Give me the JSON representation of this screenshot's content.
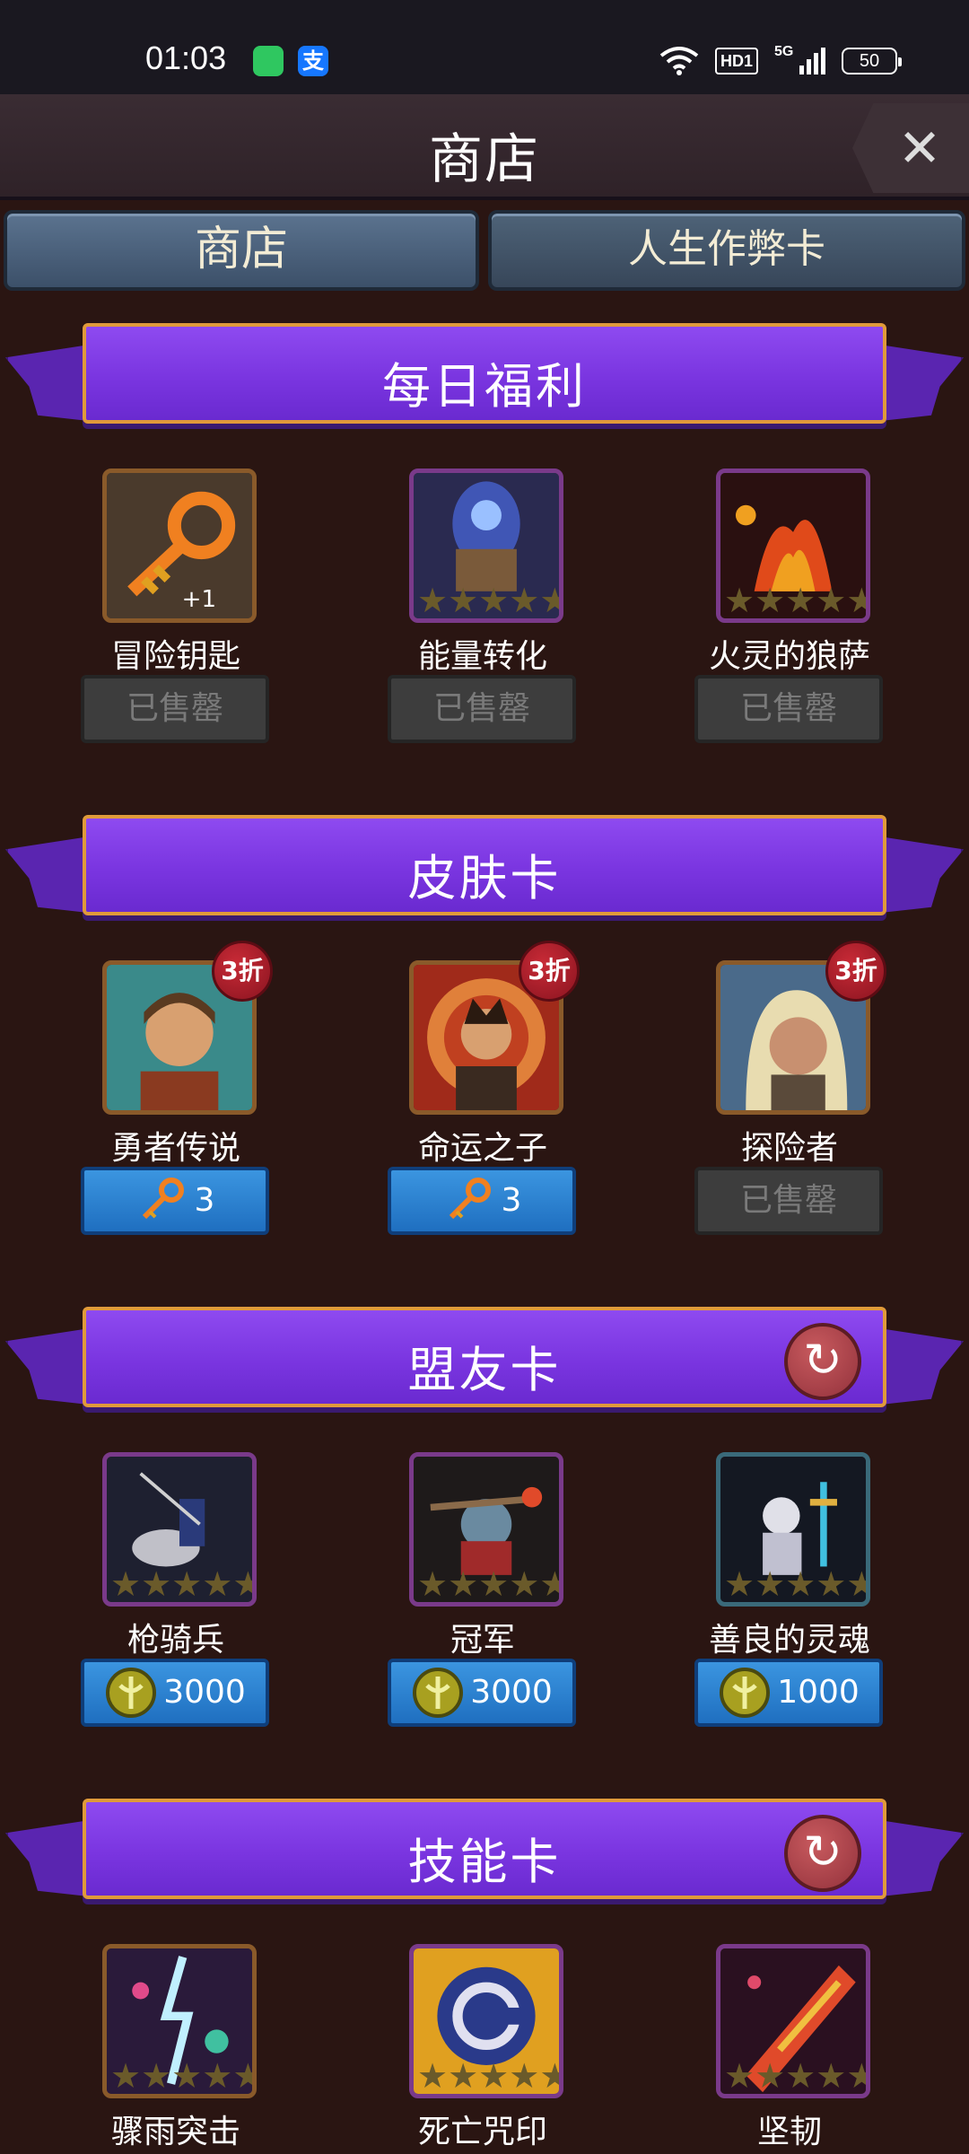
{
  "status_bar": {
    "time": "01:03",
    "pay_app_glyph": "支",
    "hd": "HD1",
    "network": "5G",
    "battery": "50"
  },
  "header": {
    "title": "商店",
    "close_glyph": "✕"
  },
  "tabs": [
    {
      "label": "商店"
    },
    {
      "label": "人生作弊卡"
    }
  ],
  "sections": {
    "daily": {
      "title": "每日福利",
      "items": [
        {
          "name": "冒险钥匙",
          "qty": "+1",
          "button": "已售罄"
        },
        {
          "name": "能量转化",
          "button": "已售罄"
        },
        {
          "name": "火灵的狼萨",
          "button": "已售罄"
        }
      ]
    },
    "skins": {
      "title": "皮肤卡",
      "items": [
        {
          "name": "勇者传说",
          "badge": "3折",
          "price": "3",
          "currency": "key-icon"
        },
        {
          "name": "命运之子",
          "badge": "3折",
          "price": "3",
          "currency": "key-icon"
        },
        {
          "name": "探险者",
          "badge": "3折",
          "button": "已售罄"
        }
      ]
    },
    "allies": {
      "title": "盟友卡",
      "items": [
        {
          "name": "枪骑兵",
          "price": "3000",
          "currency": "gold-coin-icon"
        },
        {
          "name": "冠军",
          "price": "3000",
          "currency": "gold-coin-icon"
        },
        {
          "name": "善良的灵魂",
          "price": "1000",
          "currency": "gold-coin-icon"
        }
      ]
    },
    "skills": {
      "title": "技能卡",
      "items": [
        {
          "name": "骤雨突击"
        },
        {
          "name": "死亡咒印"
        },
        {
          "name": "坚韧"
        }
      ]
    }
  },
  "star_glyph": "★",
  "refresh_glyph": "↻"
}
